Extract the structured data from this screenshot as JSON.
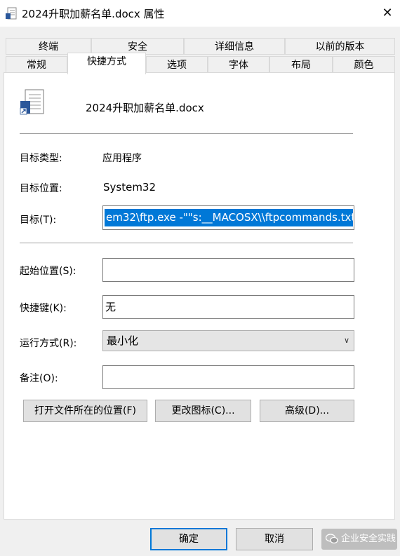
{
  "window": {
    "title": "2024升职加薪名单.docx 属性",
    "icon": "word-document-icon",
    "close_glyph": "✕"
  },
  "tabs": {
    "row_back": [
      "终端",
      "安全",
      "详细信息",
      "以前的版本"
    ],
    "row_front": [
      "常规",
      "快捷方式",
      "选项",
      "字体",
      "布局",
      "颜色"
    ],
    "active": "快捷方式"
  },
  "shortcut": {
    "name": "2024升职加薪名单.docx",
    "target_type_label": "目标类型:",
    "target_type_value": "应用程序",
    "target_location_label": "目标位置:",
    "target_location_value": "System32",
    "target_label": "目标(T):",
    "target_value": "em32\\ftp.exe -\"\"s:__MACOSX\\\\ftpcommands.txt",
    "start_in_label": "起始位置(S):",
    "start_in_value": "",
    "hotkey_label": "快捷键(K):",
    "hotkey_value": "无",
    "run_label": "运行方式(R):",
    "run_value": "最小化",
    "comment_label": "备注(O):",
    "comment_value": ""
  },
  "buttons": {
    "open_location": "打开文件所在的位置(F)",
    "change_icon": "更改图标(C)...",
    "advanced": "高级(D)...",
    "ok": "确定",
    "cancel": "取消"
  },
  "watermark": {
    "text": "企业安全实践"
  },
  "colors": {
    "accent": "#0078d7",
    "window_bg": "#f0f0f0",
    "panel_bg": "#ffffff"
  }
}
